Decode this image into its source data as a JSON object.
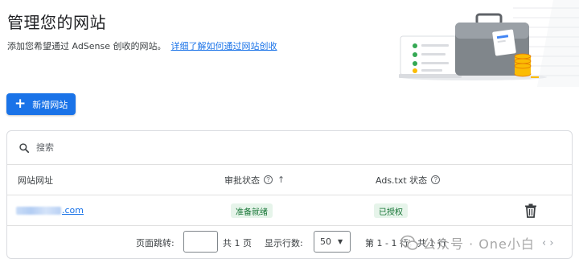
{
  "header": {
    "title": "管理您的网站",
    "subtitle": "添加您希望通过 AdSense 创收的网站。",
    "learn_more_link": "详细了解如何通过网站创收"
  },
  "toolbar": {
    "add_site_label": "新增网站"
  },
  "search": {
    "placeholder": "搜索"
  },
  "table": {
    "columns": {
      "url": "网站网址",
      "approval": "审批状态",
      "ads_txt": "Ads.txt 状态"
    },
    "rows": [
      {
        "url_visible_suffix": ".com",
        "approval_status": "准备就绪",
        "ads_txt_status": "已授权"
      }
    ]
  },
  "pagination": {
    "goto_label": "页面跳转:",
    "goto_value": "",
    "total_pages": "共 1 页",
    "rows_label": "显示行数:",
    "rows_value": "50",
    "range_text": "第 1 - 1 行，共 1 行"
  },
  "watermark": {
    "text": "公众号 · One小白"
  },
  "colors": {
    "primary": "#1a73e8",
    "success_bg": "#e6f4ea",
    "success_text": "#137333",
    "border": "#dadce0",
    "accent_yellow": "#fbbc04"
  },
  "icons": {
    "add": "plus-icon",
    "search": "search-icon",
    "help": "help-circle-icon",
    "sort": "arrow-up-icon",
    "delete": "trash-icon",
    "dropdown": "caret-down-icon"
  }
}
